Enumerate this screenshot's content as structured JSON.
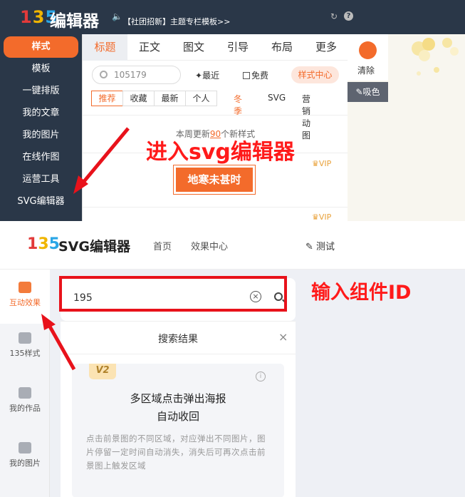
{
  "top": {
    "logo_digits": [
      "1",
      "3",
      "5"
    ],
    "brand": "编辑器",
    "notice": "【社团招新】主题专栏模板>>",
    "sidebar": [
      "样式",
      "模板",
      "一键排版",
      "我的文章",
      "我的图片",
      "在线作图",
      "运营工具",
      "SVG编辑器"
    ],
    "tabs": [
      "标题",
      "正文",
      "图文",
      "引导",
      "布局",
      "更多"
    ],
    "search_value": "105179",
    "recent": "最近",
    "free": "免费",
    "style_center": "样式中心",
    "filters": [
      "推荐",
      "收藏",
      "最新",
      "个人"
    ],
    "filters_plain": [
      "冬季",
      "SVG",
      "营销动图"
    ],
    "update_prefix": "本周更新",
    "update_count": "90",
    "update_suffix": "个新样式",
    "vip": "VIP",
    "banner": "地寒未甚时",
    "clear": "清除",
    "picker": "吸色",
    "accent": "#f36b2b",
    "annotation": "进入svg编辑器"
  },
  "bottom": {
    "logo_digits": [
      "1",
      "3",
      "5"
    ],
    "title": "SVG编辑器",
    "nav": [
      "首页",
      "效果中心"
    ],
    "test": "测试",
    "sidebar": [
      "互动效果",
      "135样式",
      "我的作品",
      "我的图片"
    ],
    "search_value": "195",
    "results_title": "搜索结果",
    "badge": "V2",
    "card_title_line1": "多区域点击弹出海报",
    "card_title_line2": "自动收回",
    "card_desc": "点击前景图的不同区域，对应弹出不同图片，图片停留一定时间自动消失，消失后可再次点击前景图上触发区域",
    "annotation": "输入组件ID",
    "highlight_color": "#e8121b"
  }
}
